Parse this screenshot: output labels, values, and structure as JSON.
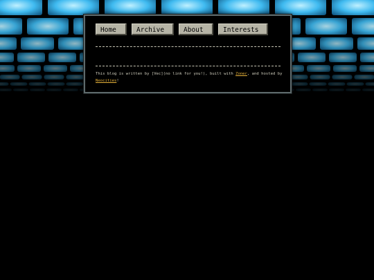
{
  "nav": {
    "items": [
      {
        "label": "Home"
      },
      {
        "label": "Archive"
      },
      {
        "label": "About"
      },
      {
        "label": "Interests"
      }
    ]
  },
  "footer": {
    "text_before": "This blog is written by [Vec](no link for you!), built with ",
    "zoner_link": "Zoner",
    "text_middle": ", and hosted by ",
    "neocities_link": "Neocities",
    "text_after": "!"
  },
  "colors": {
    "background": "#000000",
    "tile_glow": "#5fd0ff",
    "button_face": "#b6b4a6",
    "link": "#e8b33a",
    "text": "#cfcdbd"
  }
}
